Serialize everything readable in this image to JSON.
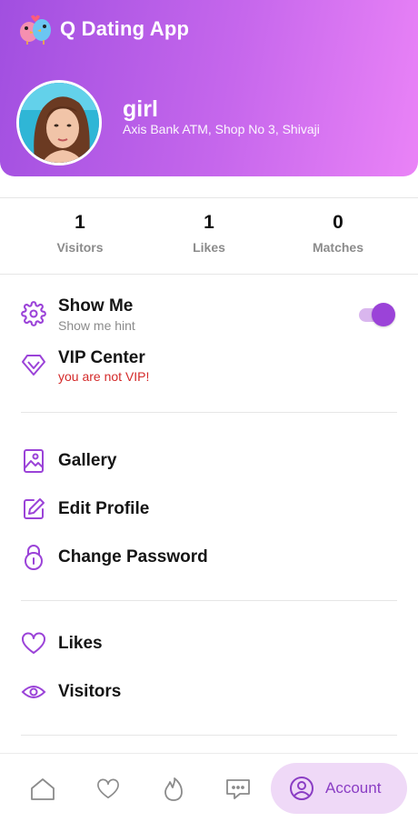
{
  "app": {
    "title": "Q Dating App",
    "accent": "#9b43d8",
    "logo_icon": "birds-logo"
  },
  "profile": {
    "name": "girl",
    "address": "Axis Bank ATM, Shop No 3, Shivaji"
  },
  "stats": [
    {
      "value": "1",
      "label": "Visitors"
    },
    {
      "value": "1",
      "label": "Likes"
    },
    {
      "value": "0",
      "label": "Matches"
    }
  ],
  "settings": {
    "show_me": {
      "title": "Show Me",
      "hint": "Show me hint",
      "icon": "gear-icon",
      "enabled": true
    },
    "vip": {
      "title": "VIP Center",
      "status": "you are not VIP!",
      "icon": "diamond-icon",
      "status_color": "#d42a2a"
    }
  },
  "menu": {
    "gallery": "Gallery",
    "edit_profile": "Edit Profile",
    "change_password": "Change Password",
    "likes": "Likes",
    "visitors": "Visitors"
  },
  "bottom_nav": {
    "items": [
      "home-icon",
      "heart-icon",
      "flame-icon",
      "chat-icon",
      "account-icon"
    ],
    "active_label": "Account"
  }
}
